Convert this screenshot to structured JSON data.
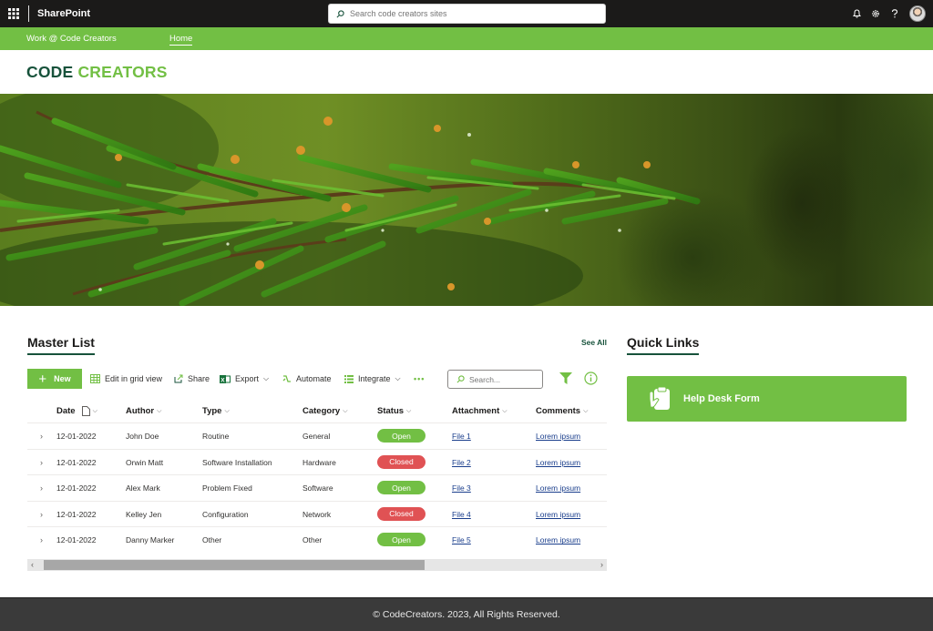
{
  "suitebar": {
    "app_name": "SharePoint",
    "search_placeholder": "Search code creators sites"
  },
  "hubnav": {
    "title": "Work @ Code Creators",
    "home_link": "Home"
  },
  "site": {
    "title_part1": "CODE",
    "title_part2": "CREATORS"
  },
  "master_list": {
    "title": "Master List",
    "see_all": "See All",
    "commands": {
      "new": "New",
      "edit_grid": "Edit in grid view",
      "share": "Share",
      "export": "Export",
      "automate": "Automate",
      "integrate": "Integrate"
    },
    "search_placeholder": "Search...",
    "columns": [
      "Date",
      "Author",
      "Type",
      "Category",
      "Status",
      "Attachment",
      "Comments"
    ],
    "rows": [
      {
        "date": "12-01-2022",
        "author": "John Doe",
        "type": "Routine",
        "category": "General",
        "status": "Open",
        "attachment": "File 1",
        "comments": "Lorem ipsum"
      },
      {
        "date": "12-01-2022",
        "author": "Orwin Matt",
        "type": "Software Installation",
        "category": "Hardware",
        "status": "Closed",
        "attachment": "File 2",
        "comments": "Lorem ipsum"
      },
      {
        "date": "12-01-2022",
        "author": "Alex Mark",
        "type": "Problem Fixed",
        "category": "Software",
        "status": "Open",
        "attachment": "File 3",
        "comments": "Lorem ipsum"
      },
      {
        "date": "12-01-2022",
        "author": "Kelley Jen",
        "type": "Configuration",
        "category": "Network",
        "status": "Closed",
        "attachment": "File 4",
        "comments": "Lorem ipsum"
      },
      {
        "date": "12-01-2022",
        "author": "Danny Marker",
        "type": "Other",
        "category": "Other",
        "status": "Open",
        "attachment": "File 5",
        "comments": "Lorem ipsum"
      }
    ],
    "status_colors": {
      "Open": "#72bf44",
      "Closed": "#e05254"
    }
  },
  "quick_links": {
    "title": "Quick Links",
    "items": [
      {
        "label": "Help Desk Form",
        "icon": "clipboard-hand-icon"
      }
    ]
  },
  "footer": {
    "text": "© CodeCreators. 2023, All Rights Reserved."
  },
  "colors": {
    "brand_green": "#72bf44",
    "brand_dark": "#17523b",
    "suite_bar": "#1b1a19",
    "footer": "#3a3a3a"
  }
}
